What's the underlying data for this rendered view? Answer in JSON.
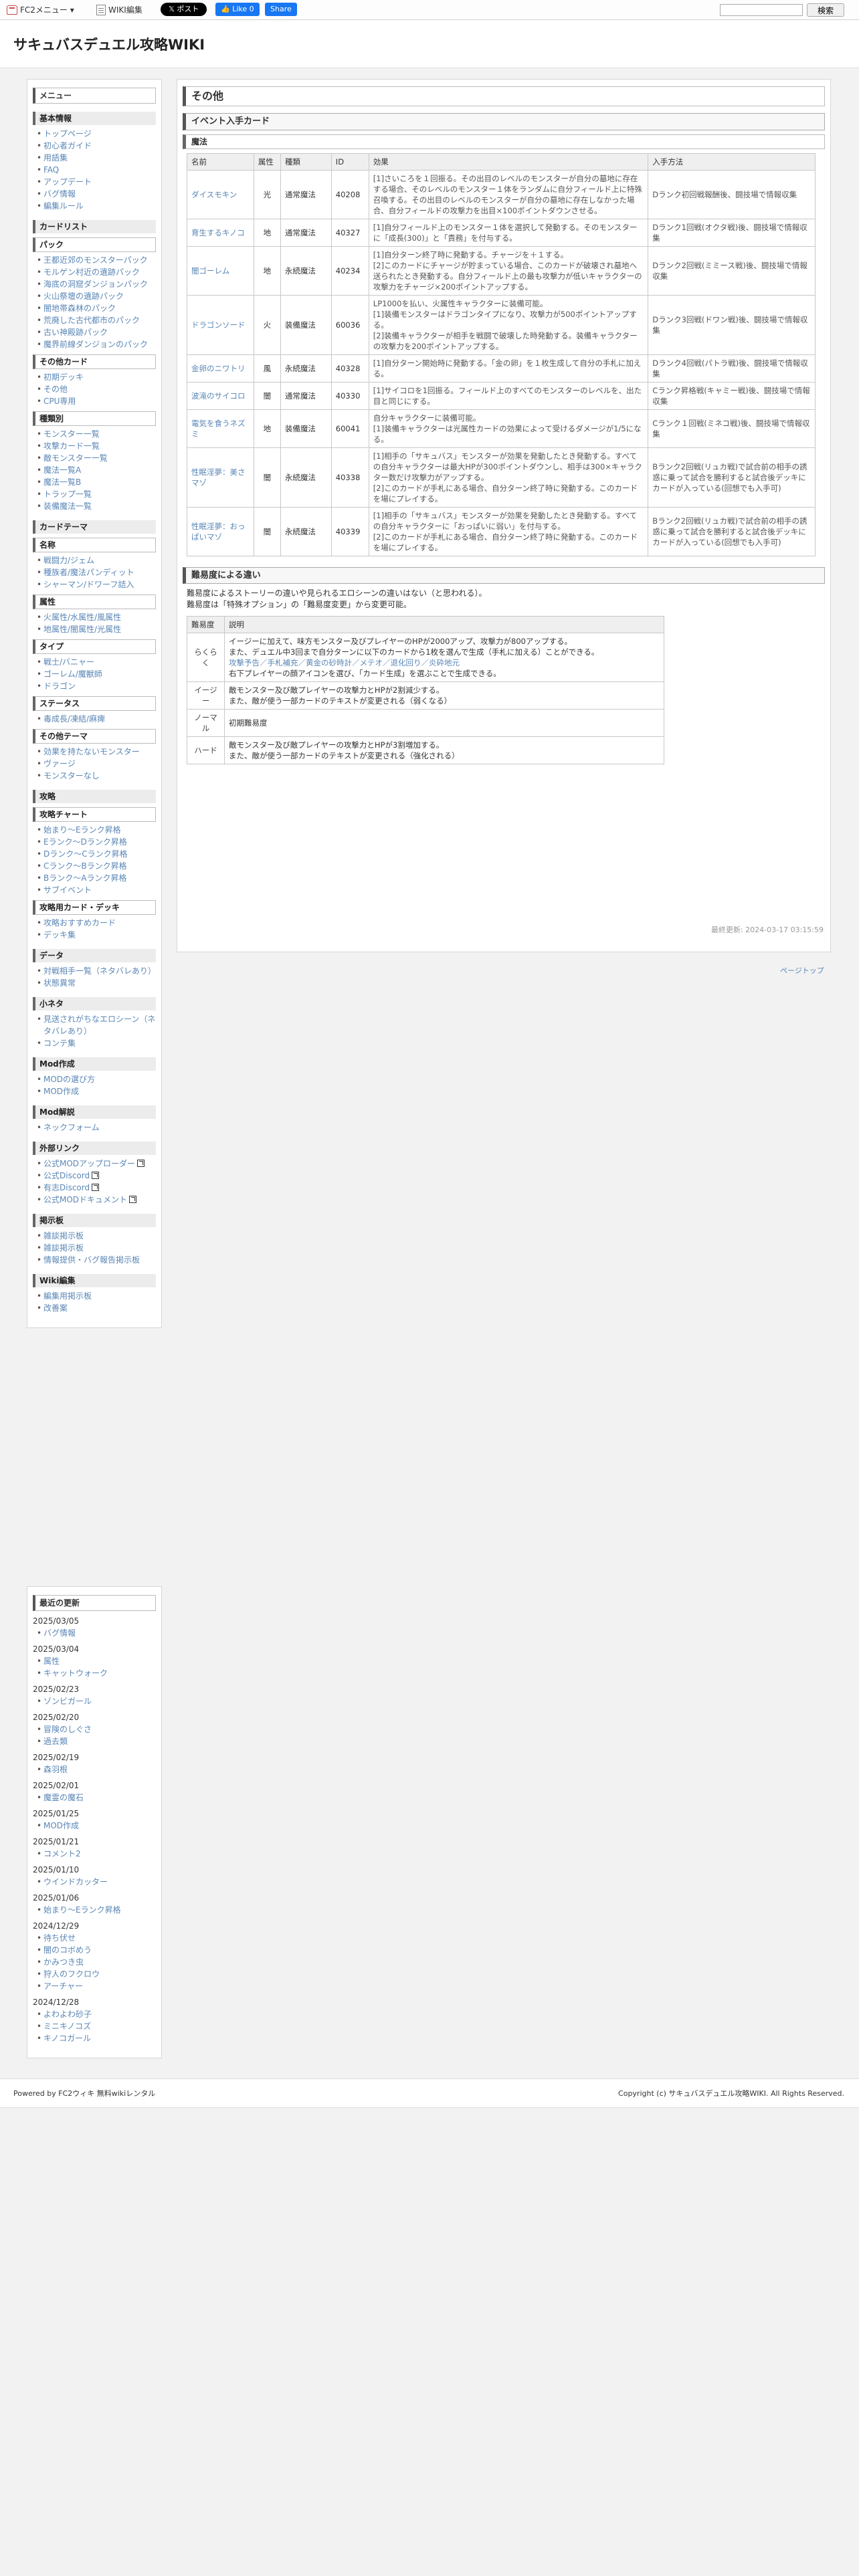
{
  "topbar": {
    "fc2_menu": "FC2メニュー ▾",
    "wiki_edit": "WIKI編集",
    "x_post": "ポスト",
    "fb_like": "Like 0",
    "fb_share": "Share",
    "search_button": "検索"
  },
  "site_title": "サキュバスデュエル攻略WIKI",
  "sidebar": {
    "menu_title": "メニュー",
    "sections": [
      {
        "title": "基本情報",
        "items": [
          "トップページ",
          "初心者ガイド",
          "用語集",
          "FAQ",
          "アップデート",
          "バグ情報",
          "編集ルール"
        ]
      },
      {
        "title": "カードリスト",
        "sub": [
          {
            "title": "パック",
            "items": [
              "王都近郊のモンスターパック",
              "モルゲン村近の遺跡パック",
              "海底の洞窟ダンジョンパック",
              "火山祭壇の遺跡パック",
              "闇地帯森林のパック",
              "荒廃した古代都市のパック",
              "古い神殿跡パック",
              "魔界前線ダンジョンのパック"
            ]
          },
          {
            "title": "その他カード",
            "items": [
              "初期デッキ",
              "その他",
              "CPU専用"
            ]
          },
          {
            "title": "種類別",
            "items": [
              "モンスター一覧",
              "攻撃カード一覧",
              "敵モンスター一覧",
              "魔法一覧A",
              "魔法一覧B",
              "トラップ一覧",
              "装備魔法一覧"
            ]
          }
        ]
      },
      {
        "title": "カードテーマ",
        "sub": [
          {
            "title": "名称",
            "items": [
              "戦闘力/ジェム",
              "種族者/魔法パンディット",
              "シャーマン/ドワーフ詰入"
            ]
          },
          {
            "title": "属性",
            "items": [
              "火属性/水属性/風属性",
              "地属性/闇属性/光属性"
            ]
          },
          {
            "title": "タイプ",
            "items": [
              "戦士/バニャー",
              "ゴーレム/魔獣師",
              "ドラゴン"
            ]
          },
          {
            "title": "ステータス",
            "items": [
              "毒成長/凍結/麻痺"
            ]
          },
          {
            "title": "その他テーマ",
            "items": [
              "効果を持たないモンスター",
              "ヴァージ",
              "モンスターなし"
            ]
          }
        ]
      },
      {
        "title": "攻略",
        "sub": [
          {
            "title": "攻略チャート",
            "items": [
              "始まり～Eランク昇格",
              "Eランク～Dランク昇格",
              "Dランク～Cランク昇格",
              "Cランク～Bランク昇格",
              "Bランク～Aランク昇格",
              "サブイベント"
            ]
          },
          {
            "title": "攻略用カード・デッキ",
            "items": [
              "攻略おすすめカード",
              "デッキ集"
            ]
          }
        ]
      },
      {
        "title": "データ",
        "items": [
          "対戦相手一覧（ネタバレあり）",
          "状態異常"
        ]
      },
      {
        "title": "小ネタ",
        "items": [
          "見送されがちなエロシーン（ネタバレあり）",
          "コンテ集"
        ]
      },
      {
        "title": "Mod作成",
        "items": [
          "MODの選び方",
          "MOD作成"
        ]
      },
      {
        "title": "Mod解説",
        "items": [
          "ネックフォーム"
        ]
      },
      {
        "title": "外部リンク",
        "items": [
          "公式MODアップローダー",
          "公式Discord",
          "有志Discord",
          "公式MODドキュメント"
        ]
      },
      {
        "title": "掲示板",
        "items": [
          "雑談掲示板",
          "雑談掲示板",
          "情報提供・バグ報告掲示板"
        ]
      },
      {
        "title": "Wiki編集",
        "items": [
          "編集用掲示板",
          "改善案"
        ]
      }
    ],
    "recent_title": "最近の更新",
    "recent": [
      {
        "date": "2025/03/05",
        "items": [
          "バグ情報"
        ]
      },
      {
        "date": "2025/03/04",
        "items": [
          "属性",
          "キャットウォーク"
        ]
      },
      {
        "date": "2025/02/23",
        "items": [
          "ゾンビガール"
        ]
      },
      {
        "date": "2025/02/20",
        "items": [
          "冒険のしぐさ",
          "過去類"
        ]
      },
      {
        "date": "2025/02/19",
        "items": [
          "森羽根"
        ]
      },
      {
        "date": "2025/02/01",
        "items": [
          "魔霊の魔石"
        ]
      },
      {
        "date": "2025/01/25",
        "items": [
          "MOD作成"
        ]
      },
      {
        "date": "2025/01/21",
        "items": [
          "コメント2"
        ]
      },
      {
        "date": "2025/01/10",
        "items": [
          "ウインドカッター"
        ]
      },
      {
        "date": "2025/01/06",
        "items": [
          "始まり～Eランク昇格"
        ]
      },
      {
        "date": "2024/12/29",
        "items": [
          "待ち伏せ",
          "闇のコボめう",
          "かみつき虫",
          "狩人のフクロウ",
          "アーチャー"
        ]
      },
      {
        "date": "2024/12/28",
        "items": [
          "よわよわ砂子",
          "ミニキノコズ",
          "キノコガール"
        ]
      }
    ]
  },
  "main": {
    "page_title": "その他",
    "event_title": "イベント入手カード",
    "magic_sub": "魔法",
    "headers": [
      "名前",
      "属性",
      "種類",
      "ID",
      "効果",
      "入手方法"
    ],
    "rows": [
      {
        "name": "ダイスモキン",
        "attr": "光",
        "kind": "通常魔法",
        "id": "40208",
        "effect": "[1]さいころを１回振る。その出目のレベルのモンスターが自分の墓地に存在する場合、そのレベルのモンスター１体をランダムに自分フィールド上に特殊召喚する。その出目のレベルのモンスターが自分の墓地に存在しなかった場合、自分フィールドの攻撃力を出目×100ポイントダウンさせる。",
        "source": "Dランク初回戦報酬後、闘技場で情報収集"
      },
      {
        "name": "育生するキノコ",
        "attr": "地",
        "kind": "通常魔法",
        "id": "40327",
        "effect": "[1]自分フィールド上のモンスター１体を選択して発動する。そのモンスターに「成長(300)」と「責務」を付与する。",
        "source": "Dランク1回戦(オクタ戦)後、闘技場で情報収集"
      },
      {
        "name": "闇ゴーレム",
        "attr": "地",
        "kind": "永続魔法",
        "id": "40234",
        "effect": "[1]自分ターン終了時に発動する。チャージを＋１する。\n[2]このカードにチャージが貯まっている場合、このカードが破壊され墓地へ送られたとき発動する。自分フィールド上の最も攻撃力が低いキャラクターの攻撃力をチャージ×200ポイントアップする。",
        "source": "Dランク2回戦(ミミース戦)後、闘技場で情報収集"
      },
      {
        "name": "ドラゴンソード",
        "attr": "火",
        "kind": "装備魔法",
        "id": "60036",
        "effect": "LP1000を払い、火属性キャラクターに装備可能。\n[1]装備モンスターはドラゴンタイプになり、攻撃力が500ポイントアップする。\n[2]装備キャラクターが相手を戦闘で破壊した時発動する。装備キャラクターの攻撃力を200ポイントアップする。",
        "source": "Dランク3回戦(ドワン戦)後、闘技場で情報収集"
      },
      {
        "name": "金卵のニワトリ",
        "attr": "風",
        "kind": "永続魔法",
        "id": "40328",
        "effect": "[1]自分ターン開始時に発動する。「金の卵」を１枚生成して自分の手札に加える。",
        "source": "Dランク4回戦(パトラ戦)後、闘技場で情報収集"
      },
      {
        "name": "波滝のサイコロ",
        "attr": "闇",
        "kind": "通常魔法",
        "id": "40330",
        "effect": "[1]サイコロを1回振る。フィールド上のすべてのモンスターのレベルを、出た目と同じにする。",
        "source": "Cランク昇格戦(キャミー戦)後、闘技場で情報収集"
      },
      {
        "name": "電気を食うネズミ",
        "attr": "地",
        "kind": "装備魔法",
        "id": "60041",
        "effect": "自分キャラクターに装備可能。\n[1]装備キャラクターは光属性カードの効果によって受けるダメージが1/5になる。",
        "source": "Cランク１回戦(ミネコ戦)後、闘技場で情報収集"
      },
      {
        "name": "性眠淫夢：美さマゾ",
        "attr": "闇",
        "kind": "永続魔法",
        "id": "40338",
        "effect": "[1]相手の「サキュバス」モンスターが効果を発動したとき発動する。すべての自分キャラクターは最大HPが300ポイントダウンし、相手は300×キャラクター数だけ攻撃力がアップする。\n[2]このカードが手札にある場合、自分ターン終了時に発動する。このカードを場にプレイする。",
        "source": "Bランク2回戦(リュカ戦)で試合前の相手の誘惑に乗って試合を勝利すると試合後デッキにカードが入っている(回想でも入手可)"
      },
      {
        "name": "性眠淫夢：おっぱいマゾ",
        "attr": "闇",
        "kind": "永続魔法",
        "id": "40339",
        "effect": "[1]相手の「サキュバス」モンスターが効果を発動したとき発動する。すべての自分キャラクターに「おっぱいに弱い」を付与する。\n[2]このカードが手札にある場合、自分ターン終了時に発動する。このカードを場にプレイする。",
        "source": "Bランク2回戦(リュカ戦)で試合前の相手の誘惑に乗って試合を勝利すると試合後デッキにカードが入っている(回想でも入手可)"
      }
    ],
    "diff_title": "難易度による違い",
    "diff_p1": "難易度によるストーリーの違いや見られるエロシーンの違いはない（と思われる）。",
    "diff_p2": "難易度は「特殊オプション」の「難易度変更」から変更可能。",
    "diff_headers": [
      "難易度",
      "説明"
    ],
    "diff_rows": [
      {
        "level": "らくらく",
        "lines": [
          "イージーに加えて、味方モンスター及びプレイヤーのHPが2000アップ、攻撃力が800アップする。",
          "また、デュエル中3回まで自分ターンに以下のカードから1枚を選んで生成（手札に加える）ことができる。",
          "攻撃予告／手札補充／黄金の砂時計／メテオ／退化回り／炎砕地元",
          "右下プレイヤーの顔アイコンを選び、「カード生成」を選ぶことで生成できる。"
        ]
      },
      {
        "level": "イージー",
        "lines": [
          "敵モンスター及び敵プレイヤーの攻撃力とHPが2割減少する。",
          "また、敵が使う一部カードのテキストが変更される（弱くなる）"
        ]
      },
      {
        "level": "ノーマル",
        "lines": [
          "初期難易度"
        ]
      },
      {
        "level": "ハード",
        "lines": [
          "敵モンスター及び敵プレイヤーの攻撃力とHPが3割増加する。",
          "また、敵が使う一部カードのテキストが変更される（強化される）"
        ]
      }
    ],
    "updated": "最終更新: 2024-03-17 03:15:59"
  },
  "page_top": "ページトップ",
  "footer": {
    "left": "Powered by FC2ウィキ 無料wikiレンタル",
    "right": "Copyright (c) サキュバスデュエル攻略WIKI. All Rights Reserved."
  }
}
